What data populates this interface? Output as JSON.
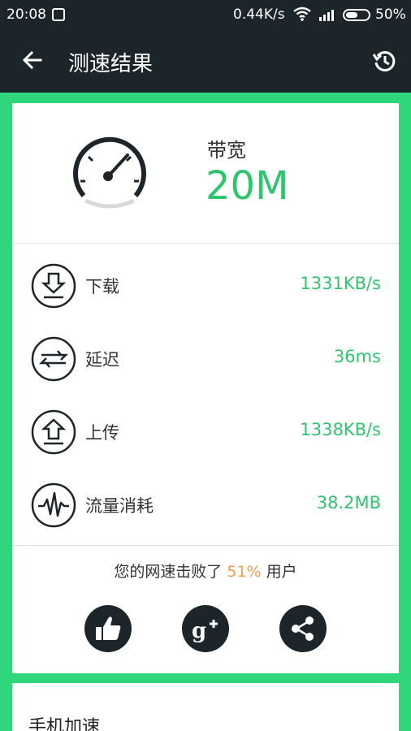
{
  "status_bar": {
    "time": "20:08",
    "net_speed": "0.44K/s",
    "battery_pct": "50%",
    "icons": [
      "notification-icon",
      "wifi-icon",
      "signal-icon",
      "battery-icon"
    ]
  },
  "app_bar": {
    "title": "测速结果",
    "back_icon": "arrow-left-icon",
    "history_icon": "history-icon"
  },
  "result": {
    "bandwidth_label": "带宽",
    "bandwidth_value": "20M",
    "gauge_icon": "speedometer-icon"
  },
  "metrics": [
    {
      "label": "下载",
      "value": "1331KB/s",
      "icon": "download-icon"
    },
    {
      "label": "延迟",
      "value": "36ms",
      "icon": "latency-icon"
    },
    {
      "label": "上传",
      "value": "1338KB/s",
      "icon": "upload-icon"
    },
    {
      "label": "流量消耗",
      "value": "38.2MB",
      "icon": "traffic-icon"
    }
  ],
  "beat": {
    "prefix": "您的网速击败了",
    "percent": "51%",
    "suffix": "用户"
  },
  "share_buttons": [
    "like-icon",
    "google-plus-icon",
    "share-icon"
  ],
  "next_card": {
    "title": "手机加速"
  },
  "colors": {
    "accent": "#2fd67a",
    "value_green": "#2fc46e",
    "dark": "#1c2529",
    "orange": "#f0a04b"
  }
}
